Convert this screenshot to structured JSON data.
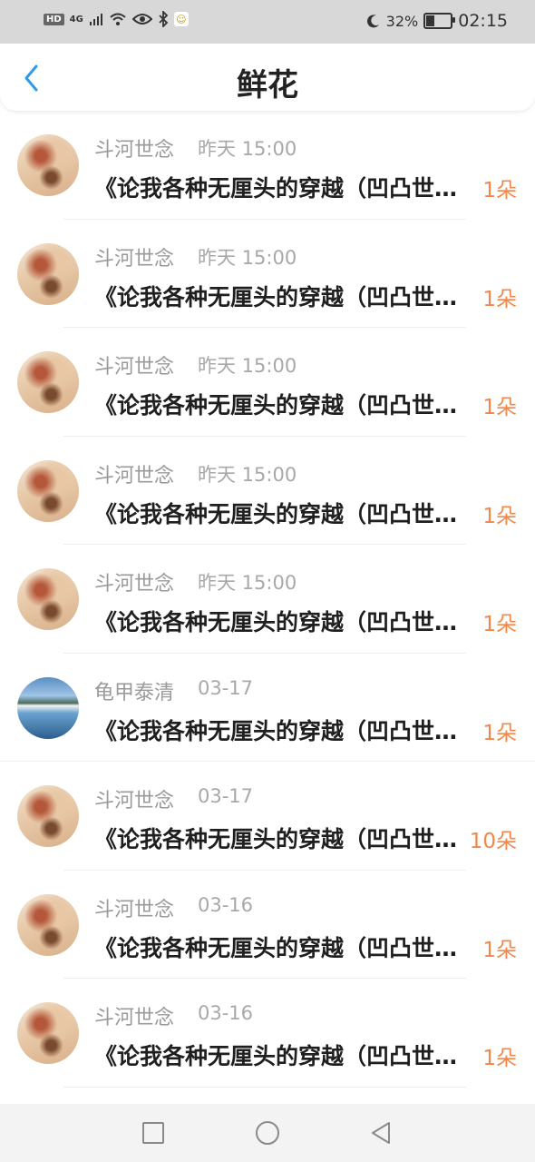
{
  "status_bar": {
    "hd": "HD",
    "network": "4G",
    "battery": "32%",
    "time": "02:15"
  },
  "header": {
    "title": "鲜花"
  },
  "items": [
    {
      "name": "斗河世念",
      "time": "昨天 15:00",
      "title": "《论我各种无厘头的穿越（凹凸世界）》",
      "count": "1朵",
      "avatar": "sepia"
    },
    {
      "name": "斗河世念",
      "time": "昨天 15:00",
      "title": "《论我各种无厘头的穿越（凹凸世界）》",
      "count": "1朵",
      "avatar": "sepia"
    },
    {
      "name": "斗河世念",
      "time": "昨天 15:00",
      "title": "《论我各种无厘头的穿越（凹凸世界）》",
      "count": "1朵",
      "avatar": "sepia"
    },
    {
      "name": "斗河世念",
      "time": "昨天 15:00",
      "title": "《论我各种无厘头的穿越（凹凸世界）》",
      "count": "1朵",
      "avatar": "sepia"
    },
    {
      "name": "斗河世念",
      "time": "昨天 15:00",
      "title": "《论我各种无厘头的穿越（凹凸世界）》",
      "count": "1朵",
      "avatar": "sepia"
    },
    {
      "name": "龟甲泰清",
      "time": "03-17",
      "title": "《论我各种无厘头的穿越（凹凸世界）》",
      "count": "1朵",
      "avatar": "lake"
    },
    {
      "name": "斗河世念",
      "time": "03-17",
      "title": "《论我各种无厘头的穿越（凹凸世界）》",
      "count": "10朵",
      "avatar": "sepia"
    },
    {
      "name": "斗河世念",
      "time": "03-16",
      "title": "《论我各种无厘头的穿越（凹凸世界）》",
      "count": "1朵",
      "avatar": "sepia"
    },
    {
      "name": "斗河世念",
      "time": "03-16",
      "title": "《论我各种无厘头的穿越（凹凸世界）》",
      "count": "1朵",
      "avatar": "sepia"
    }
  ],
  "colors": {
    "accent": "#2f9be8",
    "count": "#f0884c"
  }
}
